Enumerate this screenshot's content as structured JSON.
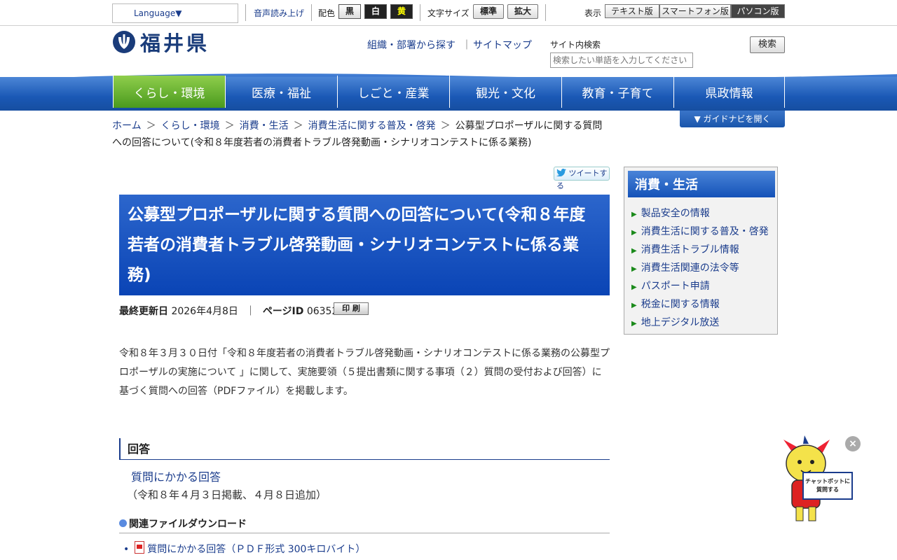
{
  "utility": {
    "language": "Language▼",
    "read_aloud": "音声読み上げ",
    "color_label": "配色",
    "color_black": "黒",
    "color_white": "白",
    "color_yellow": "黄",
    "font_size_label": "文字サイズ",
    "font_standard": "標準",
    "font_large": "拡大",
    "display_label": "表示",
    "view_text": "テキスト版",
    "view_smartphone": "スマートフォン版",
    "view_pc": "パソコン版"
  },
  "header": {
    "logo_text": "福井県",
    "org_search": "組織・部署から探す",
    "pipe": "｜",
    "sitemap": "サイトマップ",
    "search_label": "サイト内検索",
    "search_placeholder": "検索したい単語を入力してください",
    "search_button": "検索"
  },
  "gnav": [
    {
      "label": "くらし・環境",
      "active": true
    },
    {
      "label": "医療・福祉"
    },
    {
      "label": "しごと・産業"
    },
    {
      "label": "観光・文化"
    },
    {
      "label": "教育・子育て"
    },
    {
      "label": "県政情報"
    }
  ],
  "guide_button": "▼ ガイドナビを開く",
  "breadcrumb": {
    "items": [
      "ホーム",
      "くらし・環境",
      "消費・生活",
      "消費生活に関する普及・啓発"
    ],
    "sep": "＞",
    "current": "公募型プロポーザルに関する質問への回答について(令和８年度若者の消費者トラブル啓発動画・シナリオコンテストに係る業務)"
  },
  "tweet": "ツイートする",
  "page": {
    "title": "公募型プロポーザルに関する質問への回答について(令和８年度若者の消費者トラブル啓発動画・シナリオコンテストに係る業務)",
    "updated_label": "最終更新日",
    "updated_value": "2026年4月8日",
    "meta_sep": "｜",
    "page_id_label": "ページID",
    "page_id_value": "063524",
    "print": "印 刷",
    "body": "令和８年３月３０日付「令和８年度若者の消費者トラブル啓発動画・シナリオコンテストに係る業務の公募型プロポーザルの実施について 」に関して、実施要領（５提出書類に関する事項（２）質問の受付および回答）に基づく質問への回答（PDFファイル）を掲載します。",
    "section_heading": "回答",
    "answer_link": "質問にかかる回答",
    "answer_note": "（令和８年４月３日掲載、４月８日追加）",
    "download_heading": "関連ファイルダウンロード",
    "download_item": "質問にかかる回答（ＰＤＦ形式 300キロバイト）"
  },
  "sidebar": {
    "title": "消費・生活",
    "items": [
      "製品安全の情報",
      "消費生活に関する普及・啓発",
      "消費生活トラブル情報",
      "消費生活関連の法令等",
      "パスポート申請",
      "税金に関する情報",
      "地上デジタル放送"
    ]
  },
  "chatbot": {
    "close": "×",
    "sign_line1": "チャットボットに",
    "sign_line2": "質問する"
  }
}
